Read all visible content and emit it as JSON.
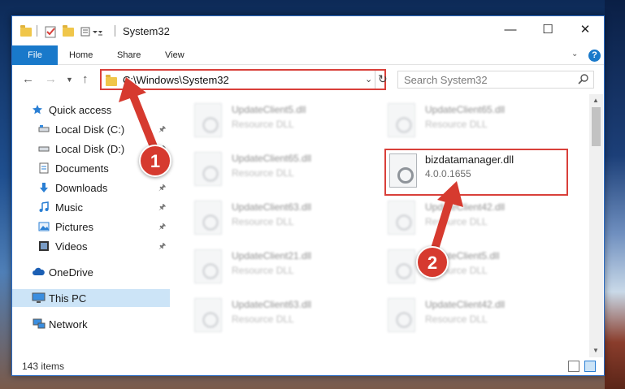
{
  "window": {
    "title": "System32",
    "controls": {
      "minimize": "—",
      "maximize": "☐",
      "close": "✕"
    }
  },
  "ribbon": {
    "tabs": [
      "File",
      "Home",
      "Share",
      "View"
    ],
    "help": "?"
  },
  "address": {
    "path": "C:\\Windows\\System32",
    "search_placeholder": "Search System32"
  },
  "navpane": {
    "quick_access": "Quick access",
    "items": [
      {
        "label": "Local Disk (C:)",
        "icon": "drive-icon",
        "pinned": true
      },
      {
        "label": "Local Disk (D:)",
        "icon": "drive-icon",
        "pinned": true
      },
      {
        "label": "Documents",
        "icon": "documents-icon",
        "pinned": true
      },
      {
        "label": "Downloads",
        "icon": "downloads-icon",
        "pinned": true
      },
      {
        "label": "Music",
        "icon": "music-icon",
        "pinned": true
      },
      {
        "label": "Pictures",
        "icon": "pictures-icon",
        "pinned": true
      },
      {
        "label": "Videos",
        "icon": "videos-icon",
        "pinned": true
      }
    ],
    "onedrive": "OneDrive",
    "this_pc": "This PC",
    "network": "Network"
  },
  "files": {
    "left_column": [
      {
        "name": "UpdateClient5.dll",
        "type": "Resource DLL"
      },
      {
        "name": "UpdateClient65.dll",
        "type": "Resource DLL"
      },
      {
        "name": "UpdateClient63.dll",
        "type": "Resource DLL"
      },
      {
        "name": "UpdateClient21.dll",
        "type": "Resource DLL"
      },
      {
        "name": "UpdateClient63.dll",
        "type": "Resource DLL"
      }
    ],
    "right_column": [
      {
        "name": "UpdateClient65.dll",
        "type": "Resource DLL"
      },
      {
        "name": "bizdatamanager.dll",
        "type": "4.0.0.1655"
      },
      {
        "name": "UpdateClient42.dll",
        "type": "Resource DLL"
      },
      {
        "name": "UpdateClient5.dll",
        "type": "Resource DLL"
      },
      {
        "name": "UpdateClient42.dll",
        "type": "Resource DLL"
      }
    ]
  },
  "status": {
    "item_count": "143 items"
  },
  "annotations": {
    "step1": "1",
    "step2": "2"
  },
  "colors": {
    "accent": "#1979ca",
    "highlight_red": "#d9403a",
    "badge_red": "#d63a2f",
    "selection": "#cce4f7"
  }
}
